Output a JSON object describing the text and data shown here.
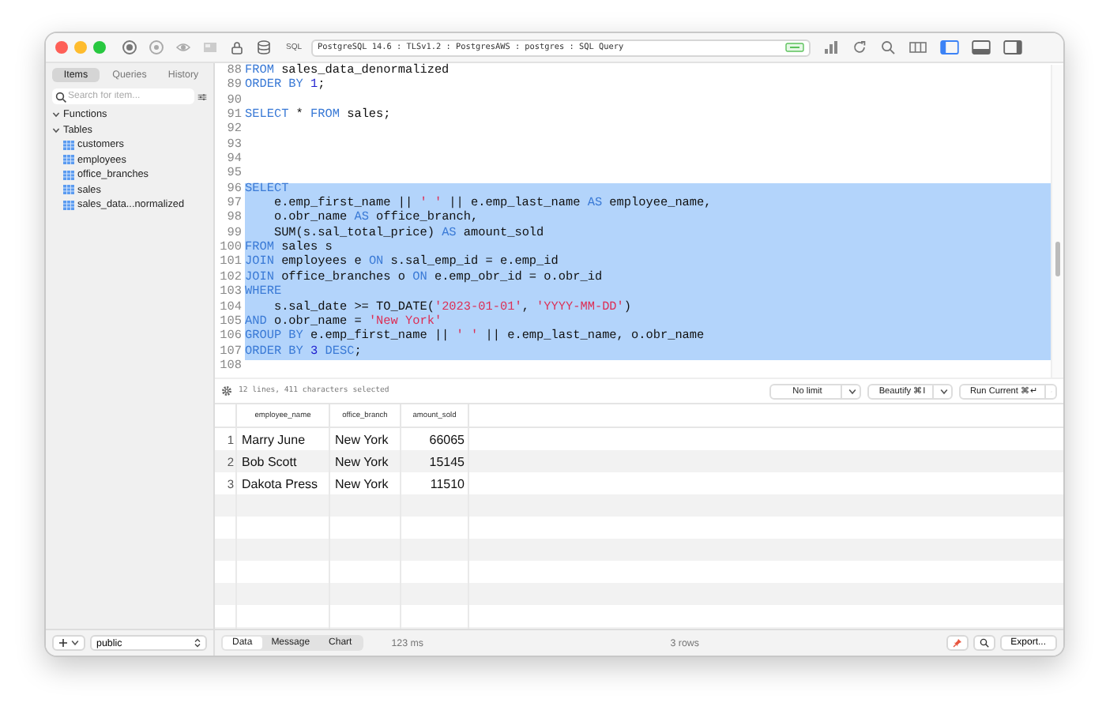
{
  "toolbar": {
    "sql_label": "SQL",
    "connection": "PostgreSQL 14.6 : TLSv1.2 : PostgresAWS : postgres : SQL Query",
    "panel_toggles": [
      {
        "kind": "left",
        "selected": true
      },
      {
        "kind": "bottom",
        "selected": false
      },
      {
        "kind": "right",
        "selected": false
      }
    ]
  },
  "sidebar": {
    "tabs": [
      {
        "label": "Items",
        "selected": true
      },
      {
        "label": "Queries",
        "selected": false
      },
      {
        "label": "History",
        "selected": false
      }
    ],
    "search": {
      "placeholder": "Search for item..."
    },
    "tree": [
      {
        "label": "Functions",
        "expanded": true
      },
      {
        "label": "Tables",
        "expanded": true,
        "children": [
          {
            "label": "customers"
          },
          {
            "label": "employees"
          },
          {
            "label": "office_branches"
          },
          {
            "label": "sales"
          },
          {
            "label": "sales_data...normalized"
          }
        ]
      }
    ]
  },
  "editor": {
    "lines": [
      {
        "number": "88",
        "selected": false,
        "tokens": [
          {
            "kind": "kw",
            "text": "FROM"
          },
          {
            "kind": "plain",
            "text": " sales_data_denormalized"
          }
        ]
      },
      {
        "number": "89",
        "selected": false,
        "tokens": [
          {
            "kind": "kw",
            "text": "ORDER BY"
          },
          {
            "kind": "num",
            "text": " 1"
          },
          {
            "kind": "plain",
            "text": ";"
          }
        ]
      },
      {
        "number": "90",
        "selected": false
      },
      {
        "number": "91",
        "selected": false,
        "tokens": [
          {
            "kind": "kw",
            "text": "SELECT"
          },
          {
            "kind": "plain",
            "text": " * "
          },
          {
            "kind": "kw",
            "text": "FROM"
          },
          {
            "kind": "plain",
            "text": " sales;"
          }
        ]
      },
      {
        "number": "92",
        "selected": false
      },
      {
        "number": "93",
        "selected": false
      },
      {
        "number": "94",
        "selected": false
      },
      {
        "number": "95",
        "selected": false
      },
      {
        "number": "96",
        "selected": true,
        "tokens": [
          {
            "kind": "kw",
            "text": "SELECT"
          }
        ]
      },
      {
        "number": "97",
        "selected": true,
        "tokens": [
          {
            "kind": "plain",
            "text": "    e.emp_first_name || "
          },
          {
            "kind": "str",
            "text": "' '"
          },
          {
            "kind": "plain",
            "text": " || e.emp_last_name "
          },
          {
            "kind": "kw",
            "text": "AS"
          },
          {
            "kind": "plain",
            "text": " employee_name,"
          }
        ]
      },
      {
        "number": "98",
        "selected": true,
        "tokens": [
          {
            "kind": "plain",
            "text": "    o.obr_name "
          },
          {
            "kind": "kw",
            "text": "AS"
          },
          {
            "kind": "plain",
            "text": " office_branch,"
          }
        ]
      },
      {
        "number": "99",
        "selected": true,
        "tokens": [
          {
            "kind": "plain",
            "text": "    SUM(s.sal_total_price) "
          },
          {
            "kind": "kw",
            "text": "AS"
          },
          {
            "kind": "plain",
            "text": " amount_sold"
          }
        ]
      },
      {
        "number": "100",
        "selected": true,
        "tokens": [
          {
            "kind": "kw",
            "text": "FROM"
          },
          {
            "kind": "plain",
            "text": " sales s"
          }
        ]
      },
      {
        "number": "101",
        "selected": true,
        "tokens": [
          {
            "kind": "kw",
            "text": "JOIN"
          },
          {
            "kind": "plain",
            "text": " employees e "
          },
          {
            "kind": "kw",
            "text": "ON"
          },
          {
            "kind": "plain",
            "text": " s.sal_emp_id = e.emp_id"
          }
        ]
      },
      {
        "number": "102",
        "selected": true,
        "tokens": [
          {
            "kind": "kw",
            "text": "JOIN"
          },
          {
            "kind": "plain",
            "text": " office_branches o "
          },
          {
            "kind": "kw",
            "text": "ON"
          },
          {
            "kind": "plain",
            "text": " e.emp_obr_id = o.obr_id"
          }
        ]
      },
      {
        "number": "103",
        "selected": true,
        "tokens": [
          {
            "kind": "kw",
            "text": "WHERE"
          }
        ]
      },
      {
        "number": "104",
        "selected": true,
        "tokens": [
          {
            "kind": "plain",
            "text": "    s.sal_date >= TO_DATE("
          },
          {
            "kind": "str",
            "text": "'2023-01-01'"
          },
          {
            "kind": "plain",
            "text": ", "
          },
          {
            "kind": "str",
            "text": "'YYYY-MM-DD'"
          },
          {
            "kind": "plain",
            "text": ")"
          }
        ]
      },
      {
        "number": "105",
        "selected": true,
        "tokens": [
          {
            "kind": "kw",
            "text": "AND"
          },
          {
            "kind": "plain",
            "text": " o.obr_name = "
          },
          {
            "kind": "str",
            "text": "'New York'"
          }
        ]
      },
      {
        "number": "106",
        "selected": true,
        "tokens": [
          {
            "kind": "kw",
            "text": "GROUP BY"
          },
          {
            "kind": "plain",
            "text": " e.emp_first_name || "
          },
          {
            "kind": "str",
            "text": "' '"
          },
          {
            "kind": "plain",
            "text": " || e.emp_last_name, o.obr_name"
          }
        ]
      },
      {
        "number": "107",
        "selected": true,
        "tokens": [
          {
            "kind": "kw",
            "text": "ORDER BY"
          },
          {
            "kind": "num",
            "text": " 3"
          },
          {
            "kind": "kw",
            "text": " DESC"
          },
          {
            "kind": "plain",
            "text": ";"
          }
        ]
      },
      {
        "number": "108",
        "selected": false
      }
    ]
  },
  "status": {
    "selection_info": "12 lines, 411 characters selected",
    "dropdowns": [
      "No limit",
      "Beautify ⌘I",
      "Run Current ⌘↵"
    ]
  },
  "results": {
    "columns": [
      "employee_name",
      "office_branch",
      "amount_sold"
    ],
    "rows": [
      {
        "number": "1",
        "cells": [
          "Marry June",
          "New York",
          "66065"
        ]
      },
      {
        "number": "2",
        "cells": [
          "Bob Scott",
          "New York",
          "15145"
        ]
      },
      {
        "number": "3",
        "cells": [
          "Dakota Press",
          "New York",
          "11510"
        ]
      }
    ]
  },
  "bottom_bar": {
    "schema": "public",
    "tabs": [
      {
        "label": "Data",
        "selected": true
      },
      {
        "label": "Message",
        "selected": false
      },
      {
        "label": "Chart",
        "selected": false
      }
    ],
    "duration": "123 ms",
    "row_count": "3 rows",
    "export": "Export..."
  }
}
